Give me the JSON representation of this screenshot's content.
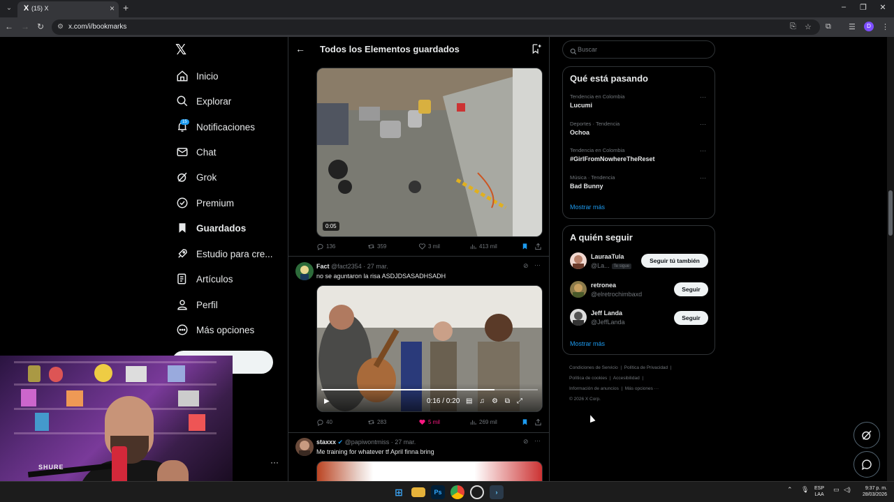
{
  "browser": {
    "tab_title": "(15) X",
    "favicon_letter": "X",
    "url": "x.com/i/bookmarks",
    "profile_letter": "D"
  },
  "nav": {
    "items": [
      {
        "label": "Inicio",
        "icon": "home-icon"
      },
      {
        "label": "Explorar",
        "icon": "search-icon"
      },
      {
        "label": "Notificaciones",
        "icon": "bell-icon"
      },
      {
        "label": "Chat",
        "icon": "mail-icon"
      },
      {
        "label": "Grok",
        "icon": "grok-icon"
      },
      {
        "label": "Premium",
        "icon": "verified-icon"
      },
      {
        "label": "Guardados",
        "icon": "bookmark-icon"
      },
      {
        "label": "Estudio para cre...",
        "icon": "rocket-icon"
      },
      {
        "label": "Artículos",
        "icon": "article-icon"
      },
      {
        "label": "Perfil",
        "icon": "person-icon"
      },
      {
        "label": "Más opciones",
        "icon": "more-icon"
      }
    ],
    "notif_count": "15",
    "post_button_partial": "r"
  },
  "main": {
    "title": "Todos los Elementos guardados",
    "tweet1": {
      "duration": "0:05",
      "replies": "136",
      "reposts": "359",
      "likes": "3 mil",
      "views": "413 mil"
    },
    "tweet2": {
      "name": "Fact",
      "handle": "@fact2354 · 27 mar.",
      "text": "no se aguntaron la risa ASDJDSASADHSADH",
      "video_time": "0:16 / 0:20",
      "progress": 0.8,
      "replies": "40",
      "reposts": "283",
      "likes": "5 mil",
      "views": "269 mil"
    },
    "tweet3": {
      "name": "staxxx",
      "handle": "@papiwontmiss · 27 mar.",
      "text": "Me training for whatever tf April finna bring"
    }
  },
  "right": {
    "search_placeholder": "Buscar",
    "trends_title": "Qué está pasando",
    "trends": [
      {
        "meta": "Tendencia en Colombia",
        "name": "Lucumi"
      },
      {
        "meta": "Deportes · Tendencia",
        "name": "Ochoa"
      },
      {
        "meta": "Tendencia en Colombia",
        "name": "#GirlFromNowhereTheReset"
      },
      {
        "meta": "Música · Tendencia",
        "name": "Bad Bunny"
      }
    ],
    "show_more": "Mostrar más",
    "wtf_title": "A quién seguir",
    "wtf": [
      {
        "name": "LauraaTula",
        "handle": "@La...",
        "badge": "Te sigue",
        "button": "Seguir tú también"
      },
      {
        "name": "retronea",
        "handle": "@elretrochimbaxd",
        "button": "Seguir"
      },
      {
        "name": "Jeff Landa",
        "handle": "@JeffLanda",
        "button": "Seguir"
      }
    ],
    "wtf_show_more": "Mostrar más",
    "footer": {
      "terms": "Condiciones de Servicio",
      "privacy": "Política de Privacidad",
      "cookies": "Política de cookies",
      "accessibility": "Accesibilidad",
      "ads": "Información de anuncios",
      "more": "Más opciones ···",
      "copyright": "© 2026 X Corp."
    }
  },
  "taskbar": {
    "lang_1": "ESP",
    "lang_2": "LAA",
    "time": "9:37 p. m.",
    "date": "28/03/2026"
  },
  "webcam": {
    "mic_sticker": "SHURE"
  },
  "colors": {
    "accent": "#1d9bf0",
    "like": "#f91880",
    "background": "#000000"
  }
}
